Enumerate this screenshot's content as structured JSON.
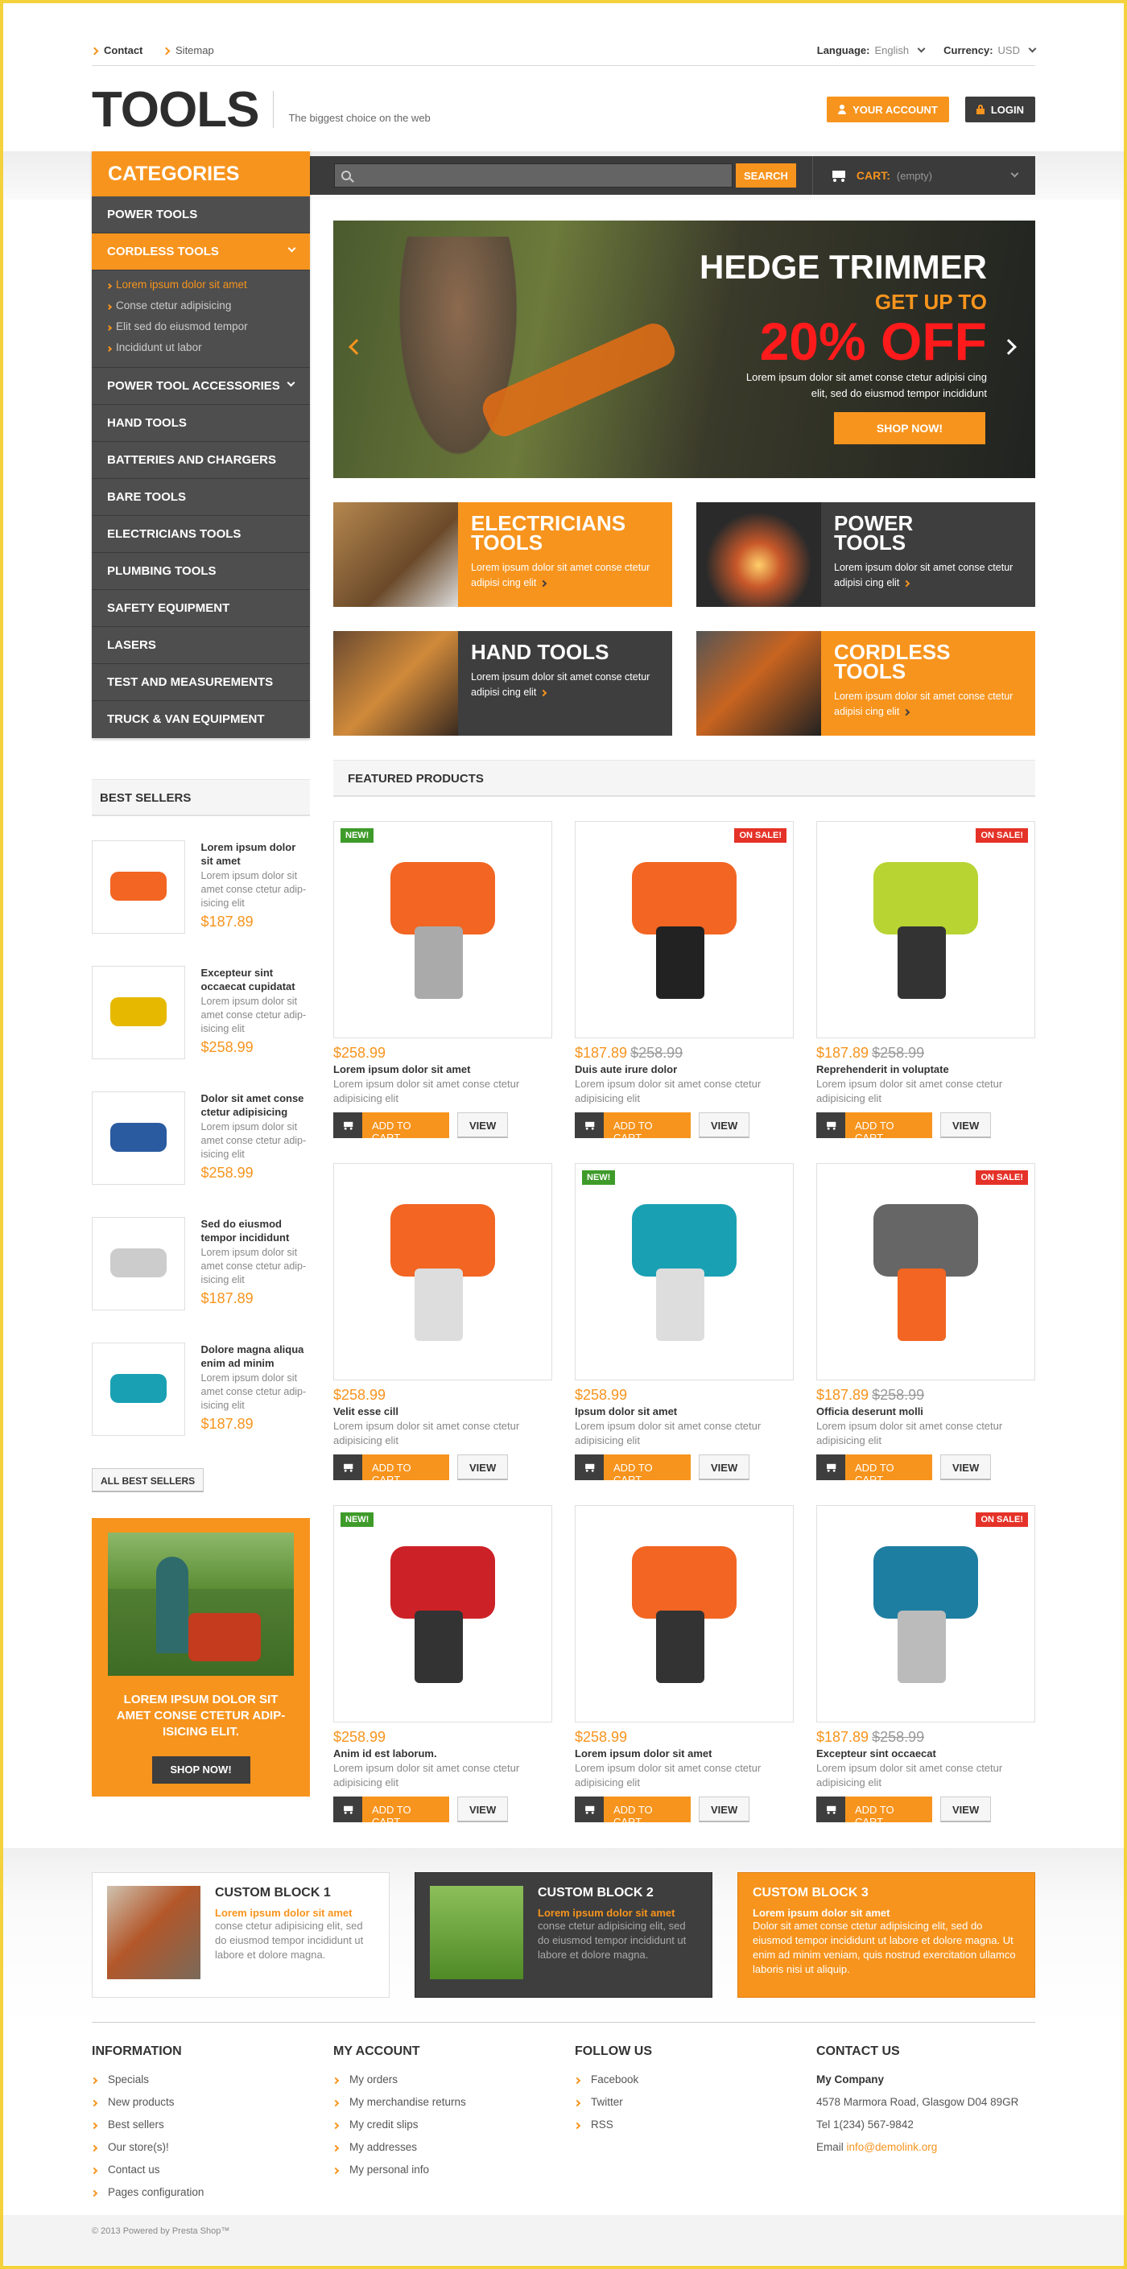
{
  "topbar": {
    "links": [
      "Contact",
      "Sitemap"
    ],
    "language_label": "Language:",
    "language_value": "English",
    "currency_label": "Currency:",
    "currency_value": "USD"
  },
  "header": {
    "logo": "TOOLS",
    "tagline": "The biggest choice on the web",
    "account_btn": "YOUR ACCOUNT",
    "login_btn": "LOGIN"
  },
  "categories": {
    "title": "CATEGORIES",
    "items": [
      "POWER TOOLS",
      "CORDLESS TOOLS",
      "POWER TOOL ACCESSORIES",
      "HAND TOOLS",
      "BATTERIES AND CHARGERS",
      "BARE TOOLS",
      "ELECTRICIANS TOOLS",
      "PLUMBING TOOLS",
      "SAFETY EQUIPMENT",
      "LASERS",
      "TEST AND MEASUREMENTS",
      "TRUCK & VAN EQUIPMENT"
    ],
    "subitems": [
      "Lorem ipsum dolor sit amet",
      "Conse ctetur adipisicing",
      "Elit sed do eiusmod tempor",
      "Incididunt ut labor"
    ]
  },
  "search": {
    "placeholder": "",
    "button": "SEARCH"
  },
  "cart": {
    "label": "CART:",
    "status": "(empty)"
  },
  "hero": {
    "title": "HEDGE TRIMMER",
    "subtitle": "GET UP TO",
    "discount": "20% OFF",
    "text": "Lorem ipsum dolor sit amet conse ctetur adipisi cing elit, sed do eiusmod tempor incididunt",
    "button": "SHOP NOW!"
  },
  "tiles": [
    {
      "title1": "ELECTRICIANS",
      "title2": "TOOLS",
      "text": "Lorem ipsum dolor sit amet conse ctetur adipisi cing elit"
    },
    {
      "title1": "POWER",
      "title2": "TOOLS",
      "text": "Lorem ipsum dolor sit amet conse ctetur adipisi cing elit"
    },
    {
      "title1": "HAND TOOLS",
      "title2": "",
      "text": "Lorem ipsum dolor sit amet conse ctetur adipisi cing elit"
    },
    {
      "title1": "CORDLESS",
      "title2": "TOOLS",
      "text": "Lorem ipsum dolor sit amet conse ctetur adipisi cing elit"
    }
  ],
  "featured": {
    "title": "FEATURED PRODUCTS",
    "add_to_cart": "ADD TO CART",
    "view": "VIEW",
    "new_badge": "NEW!",
    "sale_badge": "ON SALE!",
    "products": [
      {
        "price": "$258.99",
        "old": "",
        "name": "Lorem ipsum dolor sit amet",
        "desc": "Lorem ipsum dolor sit amet conse ctetur adipisicing elit",
        "badge": "new"
      },
      {
        "price": "$187.89",
        "old": "$258.99",
        "name": "Duis aute irure dolor",
        "desc": "Lorem ipsum dolor sit amet conse ctetur adipisicing elit",
        "badge": "sale"
      },
      {
        "price": "$187.89",
        "old": "$258.99",
        "name": "Reprehenderit in voluptate",
        "desc": "Lorem ipsum dolor sit amet conse ctetur adipisicing elit",
        "badge": "sale"
      },
      {
        "price": "$258.99",
        "old": "",
        "name": "Velit esse cill",
        "desc": "Lorem ipsum dolor sit amet conse ctetur adipisicing elit",
        "badge": ""
      },
      {
        "price": "$258.99",
        "old": "",
        "name": "Ipsum dolor sit amet",
        "desc": "Lorem ipsum dolor sit amet conse ctetur adipisicing elit",
        "badge": "new"
      },
      {
        "price": "$187.89",
        "old": "$258.99",
        "name": "Officia deserunt molli",
        "desc": "Lorem ipsum dolor sit amet conse ctetur adipisicing elit",
        "badge": "sale"
      },
      {
        "price": "$258.99",
        "old": "",
        "name": "Anim id est laborum.",
        "desc": "Lorem ipsum dolor sit amet conse ctetur adipisicing elit",
        "badge": "new"
      },
      {
        "price": "$258.99",
        "old": "",
        "name": "Lorem ipsum dolor sit amet",
        "desc": "Lorem ipsum dolor sit amet conse ctetur adipisicing elit",
        "badge": ""
      },
      {
        "price": "$187.89",
        "old": "$258.99",
        "name": "Excepteur sint occaecat",
        "desc": "Lorem ipsum dolor sit amet conse ctetur adipisicing elit",
        "badge": "sale"
      }
    ]
  },
  "bestsellers": {
    "title": "BEST SELLERS",
    "all": "ALL BEST SELLERS",
    "items": [
      {
        "name": "Lorem ipsum dolor sit amet",
        "desc": "Lorem ipsum dolor sit amet conse ctetur adip-isicing elit",
        "price": "$187.89"
      },
      {
        "name": "Excepteur sint occaecat cupidatat",
        "desc": "Lorem ipsum dolor sit amet conse ctetur adip-isicing elit",
        "price": "$258.99"
      },
      {
        "name": "Dolor sit amet conse ctetur adipisicing",
        "desc": "Lorem ipsum dolor sit amet conse ctetur adip-isicing elit",
        "price": "$258.99"
      },
      {
        "name": "Sed do eiusmod tempor incididunt",
        "desc": "Lorem ipsum dolor sit amet conse ctetur adip-isicing elit",
        "price": "$187.89"
      },
      {
        "name": "Dolore magna aliqua enim ad minim",
        "desc": "Lorem ipsum dolor sit amet conse ctetur adip-isicing elit",
        "price": "$187.89"
      }
    ]
  },
  "promo": {
    "text": "LOREM IPSUM DOLOR SIT AMET CONSE CTETUR ADIP-ISICING ELIT.",
    "button": "SHOP NOW!"
  },
  "custom_blocks": [
    {
      "title": "CUSTOM BLOCK 1",
      "lead": "Lorem ipsum dolor sit amet",
      "text": "conse ctetur adipisicing elit, sed do eiusmod tempor incididunt ut labore et dolore magna."
    },
    {
      "title": "CUSTOM BLOCK 2",
      "lead": "Lorem ipsum dolor sit amet",
      "text": "conse ctetur adipisicing elit, sed do eiusmod tempor incididunt ut labore et dolore magna."
    },
    {
      "title": "CUSTOM BLOCK 3",
      "lead": "Lorem ipsum dolor sit amet",
      "text": "Dolor sit amet conse ctetur adipisicing elit, sed do eiusmod tempor incididunt ut labore et dolore magna. Ut enim ad minim veniam, quis nostrud exercitation ullamco laboris nisi ut aliquip."
    }
  ],
  "footer": {
    "information": {
      "title": "INFORMATION",
      "links": [
        "Specials",
        "New products",
        "Best sellers",
        "Our store(s)!",
        "Contact us",
        "Pages configuration"
      ]
    },
    "account": {
      "title": "MY ACCOUNT",
      "links": [
        "My orders",
        "My merchandise returns",
        "My credit slips",
        "My addresses",
        "My personal info"
      ]
    },
    "follow": {
      "title": "FOLLOW US",
      "links": [
        "Facebook",
        "Twitter",
        "RSS"
      ]
    },
    "contact": {
      "title": "CONTACT US",
      "company": "My Company",
      "address": "4578 Marmora Road, Glasgow D04 89GR",
      "tel": "Tel 1(234) 567-9842",
      "email_label": "Email",
      "email": "info@demolink.org"
    },
    "copyright": "© 2013 Powered by Presta Shop™"
  }
}
